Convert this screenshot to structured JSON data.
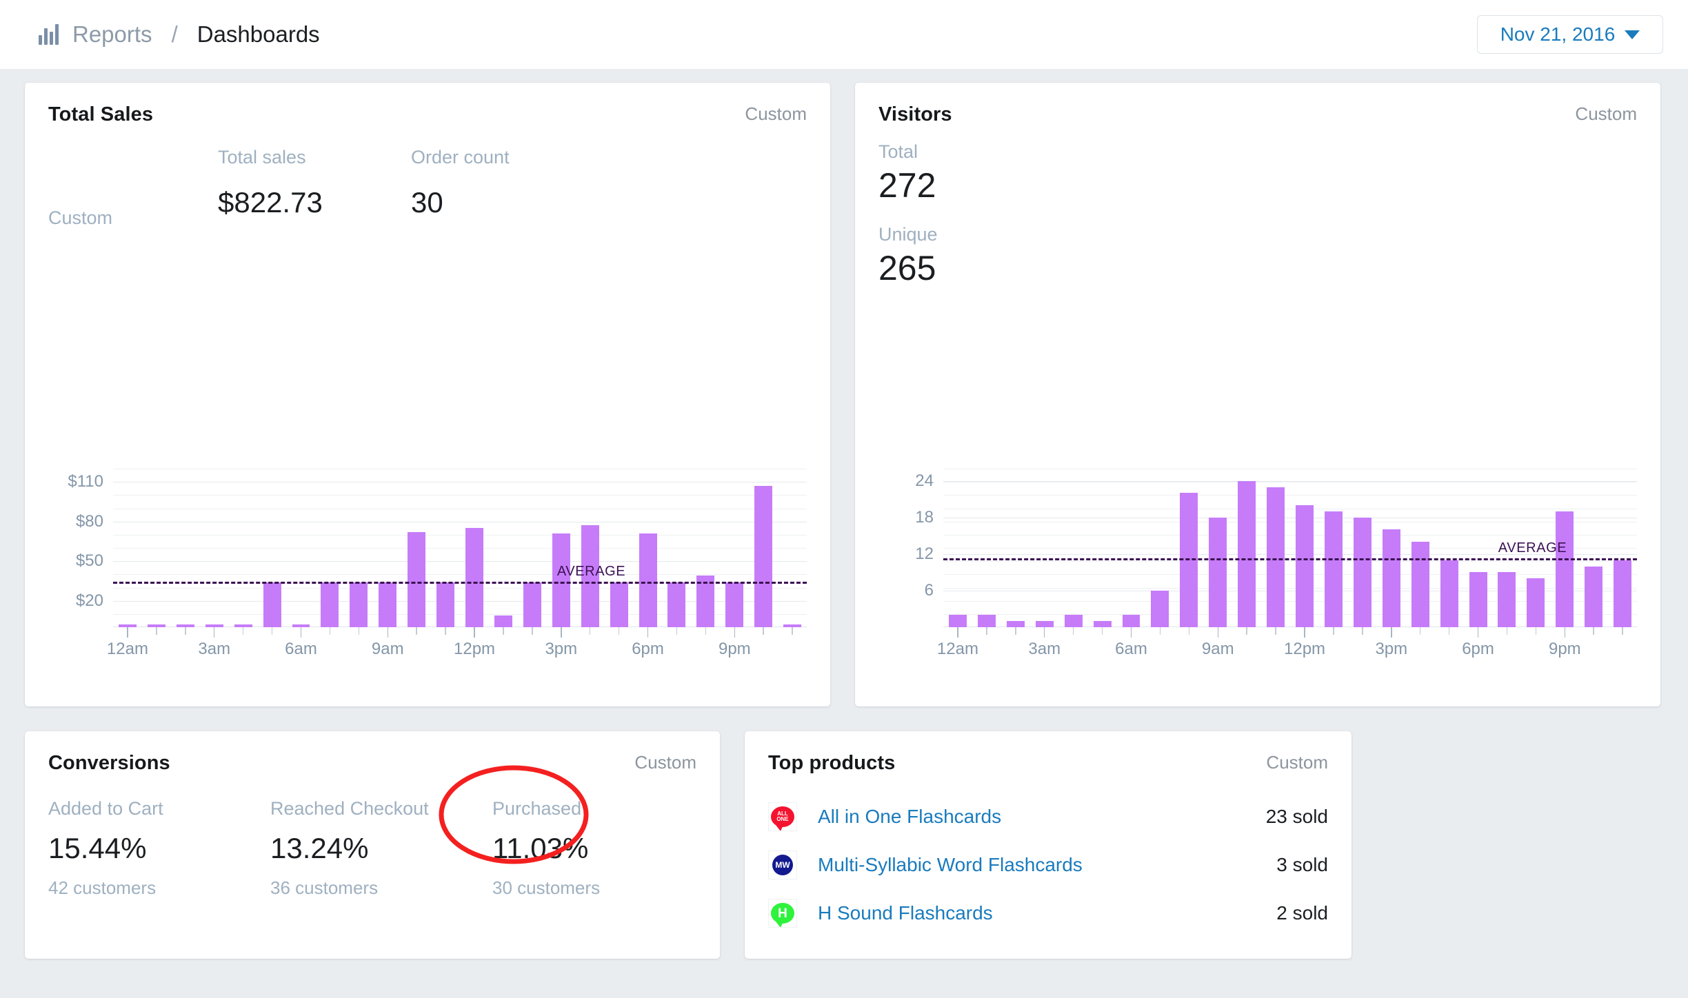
{
  "header": {
    "logo_icon": "bar-chart-icon",
    "breadcrumb_parent": "Reports",
    "breadcrumb_separator": "/",
    "breadcrumb_current": "Dashboards",
    "date_range": "Nov 21, 2016",
    "caret_icon": "chevron-down-icon"
  },
  "colors": {
    "bar": "#c67cf9",
    "average_line": "#3b1152",
    "link": "#1a7bbd",
    "annotation": "#f42020",
    "page_bg": "#eaedf0"
  },
  "total_sales": {
    "title": "Total Sales",
    "range_label": "Custom",
    "left_range_label": "Custom",
    "metrics": [
      {
        "label": "Total sales",
        "value": "$822.73"
      },
      {
        "label": "Order count",
        "value": "30"
      }
    ],
    "chart_data": {
      "type": "bar",
      "title": "Total Sales",
      "xlabel": "",
      "ylabel": "",
      "ylim": [
        0,
        120
      ],
      "yticks": [
        20,
        50,
        80,
        110
      ],
      "ytick_labels": [
        "$20",
        "$50",
        "$80",
        "$110"
      ],
      "grid": true,
      "categories": [
        "12am",
        "1am",
        "2am",
        "3am",
        "4am",
        "5am",
        "6am",
        "7am",
        "8am",
        "9am",
        "10am",
        "11am",
        "12pm",
        "1pm",
        "2pm",
        "3pm",
        "4pm",
        "5pm",
        "6pm",
        "7pm",
        "8pm",
        "9pm",
        "10pm",
        "11pm"
      ],
      "tick_labels": [
        "12am",
        "",
        "",
        "3am",
        "",
        "",
        "6am",
        "",
        "",
        "9am",
        "",
        "",
        "12pm",
        "",
        "",
        "3pm",
        "",
        "",
        "6pm",
        "",
        "",
        "9pm",
        "",
        ""
      ],
      "values": [
        2,
        2,
        2,
        2,
        2,
        34,
        2,
        34,
        34,
        34,
        72,
        34,
        75,
        9,
        34,
        71,
        77,
        34,
        71,
        34,
        39,
        34,
        107,
        2
      ],
      "average": 34.3,
      "average_label": "AVERAGE",
      "legend": []
    }
  },
  "visitors": {
    "title": "Visitors",
    "range_label": "Custom",
    "metrics": [
      {
        "label": "Total",
        "value": "272"
      },
      {
        "label": "Unique",
        "value": "265"
      }
    ],
    "chart_data": {
      "type": "bar",
      "title": "Visitors",
      "xlabel": "",
      "ylabel": "",
      "ylim": [
        0,
        26
      ],
      "yticks": [
        6,
        12,
        18,
        24
      ],
      "ytick_labels": [
        "6",
        "12",
        "18",
        "24"
      ],
      "grid": true,
      "categories": [
        "12am",
        "1am",
        "2am",
        "3am",
        "4am",
        "5am",
        "6am",
        "7am",
        "8am",
        "9am",
        "10am",
        "11am",
        "12pm",
        "1pm",
        "2pm",
        "3pm",
        "4pm",
        "5pm",
        "6pm",
        "7pm",
        "8pm",
        "9pm",
        "10pm",
        "11pm"
      ],
      "tick_labels": [
        "12am",
        "",
        "",
        "3am",
        "",
        "",
        "6am",
        "",
        "",
        "9am",
        "",
        "",
        "12pm",
        "",
        "",
        "3pm",
        "",
        "",
        "6pm",
        "",
        "",
        "9pm",
        "",
        ""
      ],
      "values": [
        2,
        2,
        1,
        1,
        2,
        1,
        2,
        6,
        22,
        18,
        24,
        23,
        20,
        19,
        18,
        16,
        14,
        11,
        9,
        9,
        8,
        19,
        10,
        11
      ],
      "average": 11.3,
      "average_label": "AVERAGE",
      "legend": []
    }
  },
  "conversions": {
    "title": "Conversions",
    "range_label": "Custom",
    "items": [
      {
        "label": "Added to Cart",
        "value": "15.44%",
        "sub": "42 customers"
      },
      {
        "label": "Reached Checkout",
        "value": "13.24%",
        "sub": "36 customers"
      },
      {
        "label": "Purchased",
        "value": "11.03%",
        "sub": "30 customers"
      }
    ],
    "annotation": {
      "shape": "ellipse",
      "target": "Purchased"
    }
  },
  "top_products": {
    "title": "Top products",
    "range_label": "Custom",
    "rows": [
      {
        "thumb": "all-in-one-flashcards-thumb",
        "thumb_text": "ALL ONE",
        "name": "All in One Flashcards",
        "sold": "23 sold"
      },
      {
        "thumb": "multi-syllabic-word-flashcards-thumb",
        "thumb_text": "MW",
        "name": "Multi-Syllabic Word Flashcards",
        "sold": "3 sold"
      },
      {
        "thumb": "h-sound-flashcards-thumb",
        "thumb_text": "H",
        "name": "H Sound Flashcards",
        "sold": "2 sold"
      }
    ]
  }
}
